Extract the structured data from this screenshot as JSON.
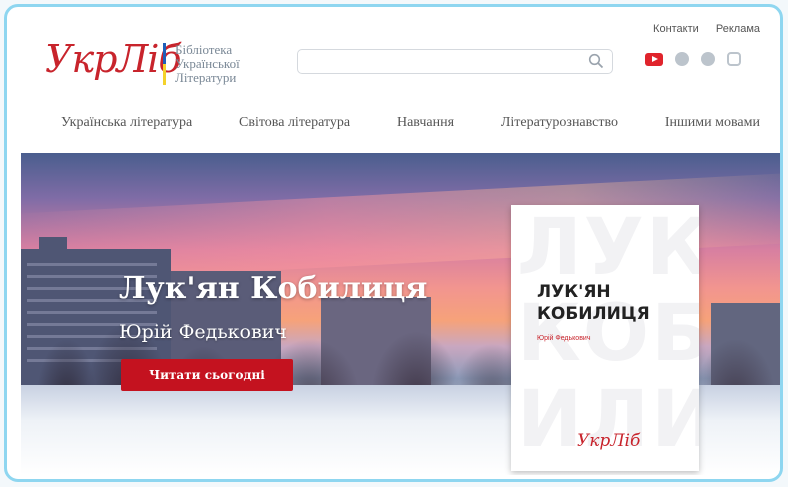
{
  "top_links": {
    "contacts": "Контакти",
    "ads": "Реклама"
  },
  "logo": {
    "word": "УкрЛіб",
    "subtitle_line1": "Бібліотека",
    "subtitle_line2": "Української",
    "subtitle_line3": "Літератури"
  },
  "search": {
    "placeholder": "",
    "value": "",
    "icon": "search-icon"
  },
  "socials": [
    "youtube-icon",
    "telegram-icon",
    "facebook-icon",
    "instagram-icon"
  ],
  "nav": [
    "Українська література",
    "Світова література",
    "Навчання",
    "Літературознавство",
    "Іншими мовами"
  ],
  "hero": {
    "title": "Лук'ян Кобилиця",
    "author": "Юрій Федькович",
    "button": "Читати сьогодні"
  },
  "cover": {
    "title_line1": "ЛУК'ЯН",
    "title_line2": "КОБИЛИЦЯ",
    "author": "Юрій Федькович",
    "publisher": "УкрЛіб",
    "watermark": "ЛУК КОБ ИЛИ"
  },
  "colors": {
    "brand_red": "#c8242c",
    "button_red": "#c4121f",
    "frame": "#8ed6f0"
  }
}
